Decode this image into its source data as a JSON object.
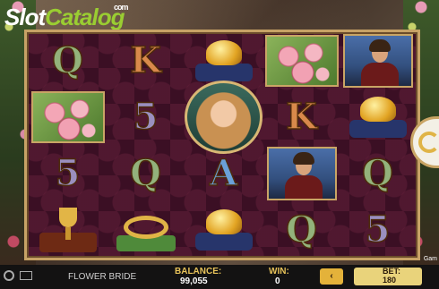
{
  "brand": {
    "logo_main": "Slot",
    "logo_accent": "Catalog",
    "logo_suffix": "com"
  },
  "game": {
    "title": "FLOWER BRIDE"
  },
  "reels": [
    [
      "Q",
      "roses",
      "5",
      "goblet"
    ],
    [
      "K",
      "5",
      "Q",
      "crown"
    ],
    [
      "gold-helmet",
      "bride",
      "A",
      "gold-helmet"
    ],
    [
      "roses",
      "K",
      "prince",
      "Q"
    ],
    [
      "prince",
      "gold-helmet",
      "Q",
      "5"
    ]
  ],
  "status": {
    "balance_label": "BALANCE:",
    "balance_value": "99,055",
    "win_label": "WIN:",
    "win_value": "0",
    "bet_label": "BET:",
    "bet_value": "180",
    "bet_prev_button": "‹",
    "game_right_label": "Gam"
  }
}
